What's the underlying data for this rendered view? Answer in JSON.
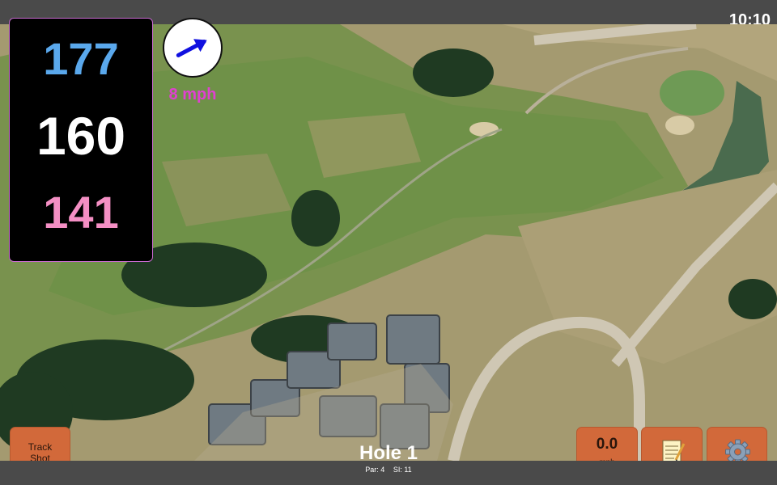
{
  "status": {
    "time": "10:10"
  },
  "distances": {
    "back": "177",
    "middle": "160",
    "front": "141",
    "colors": {
      "back": "#5aa8ec",
      "middle": "#ffffff",
      "front": "#f48fc4"
    }
  },
  "wind": {
    "speed": "8 mph",
    "color": "#e040d0",
    "arrow_color": "#1010e0",
    "direction_deg": 62
  },
  "map": {
    "icon": "aerial-satellite-map"
  },
  "controls": {
    "track_shot": "Track\nShot",
    "speed_value": "0.0",
    "speed_unit": "mph",
    "notes_icon": "notepad-icon",
    "settings_icon": "gear-icon",
    "accent": "#d2693a"
  },
  "hole": {
    "title": "Hole 1",
    "par": "Par: 4",
    "si": "SI: 11"
  }
}
